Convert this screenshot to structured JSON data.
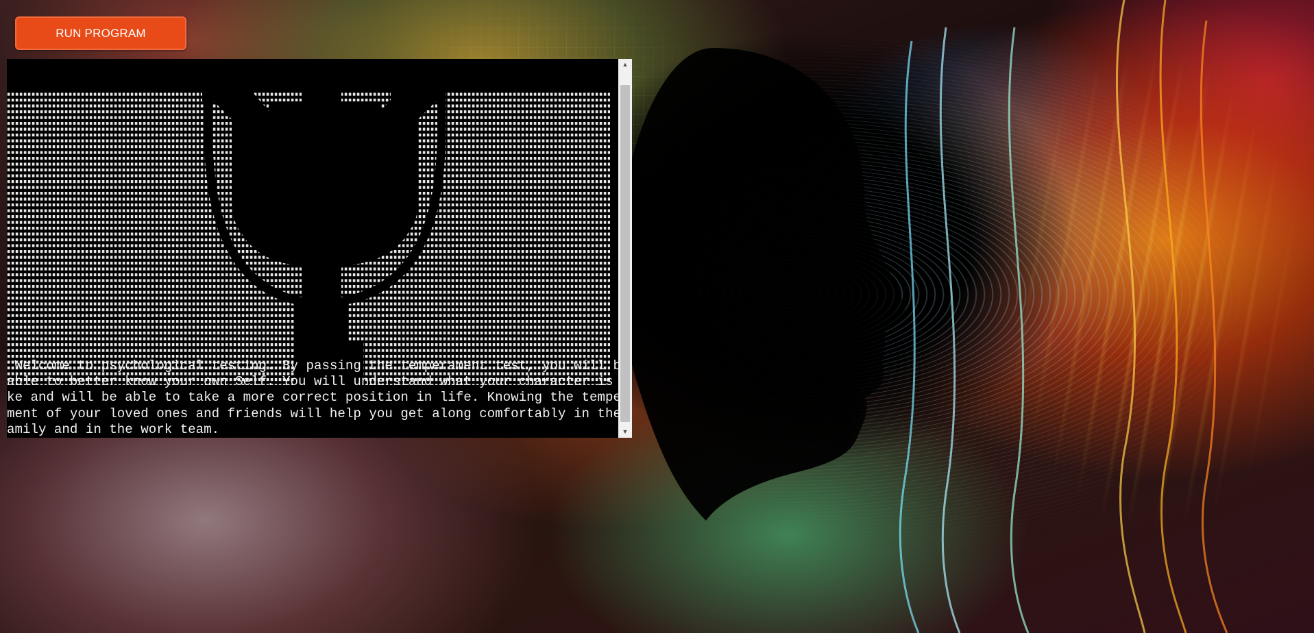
{
  "toolbar": {
    "run_label": "RUN PROGRAM"
  },
  "terminal": {
    "lines": [
      " Welcome to psychological testing. By passing the temperament test, you will be",
      "able to better know your own Self. You will understand what your character is li",
      "ke and will be able to take a more correct position in life. Knowing the tempera",
      "ment of your loved ones and friends will help you get along comfortably in the f",
      "amily and in the work team."
    ],
    "ascii_art_symbol": "psi-symbol",
    "art_char": "."
  },
  "colors": {
    "button_bg": "#e84a18",
    "terminal_bg": "#000000",
    "terminal_fg": "#f2f2f2"
  }
}
